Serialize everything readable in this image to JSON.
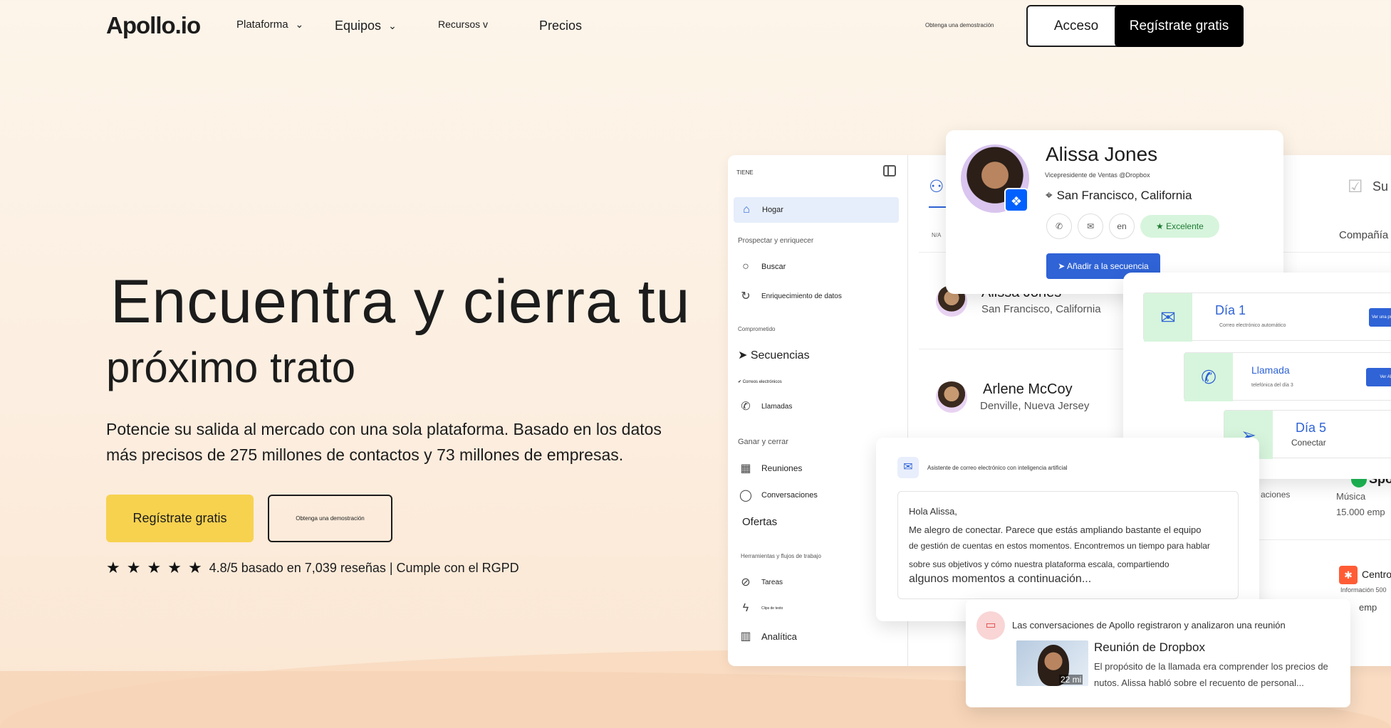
{
  "nav": {
    "logo": "Apollo.io",
    "items": [
      {
        "label": "Plataforma",
        "chevron": "⌄"
      },
      {
        "label": "Equipos",
        "chevron": "⌄"
      },
      {
        "label": "Recursos v"
      },
      {
        "label": "Precios"
      }
    ],
    "demo_link": "Obtenga una demostración",
    "login": "Acceso",
    "signup": "Regístrate gratis"
  },
  "hero": {
    "title_line1": "Encuentra y cierra tu",
    "title_line2": "próximo trato",
    "subtitle": "Potencie su salida al mercado con una sola plataforma. Basado en los datos más precisos de 275 millones de contactos y 73 millones de empresas.",
    "cta_primary": "Regístrate gratis",
    "cta_secondary": "Obtenga una demostración",
    "rating": 5,
    "rating_text": "4.8/5 basado en 7,039 reseñas | Cumple con el RGPD"
  },
  "app": {
    "sidebar": {
      "title": "TIENE",
      "home": "Hogar",
      "sec_prospect": "Prospectar y enriquecer",
      "search": "Buscar",
      "enrich": "Enriquecimiento de datos",
      "sec_engaged": "Comprometido",
      "sequences": "➤ Secuencias",
      "emails": "✔ Correos electrónicos",
      "calls": "Llamadas",
      "sec_win": "Ganar y cerrar",
      "meetings": "Reuniones",
      "conversations": "Conversaciones",
      "offers": "Ofertas",
      "sec_tools": "Herramientas y flujos de trabajo",
      "tasks": "Tareas",
      "snippets": "Clips de texto",
      "analytics": "Analítica"
    },
    "tabs": {
      "su": "Su",
      "company": "Compañía",
      "na": "N/A"
    },
    "rows": [
      {
        "name": "Alissa Jones",
        "location": "San Francisco, California"
      },
      {
        "name": "Arlene McCoy",
        "location": "Denville, Nueva Jersey"
      }
    ],
    "companies": {
      "spotify": "Spo",
      "music": "Música",
      "emp1": "15.000 emp",
      "aciones": "aciones",
      "centro": "Centro",
      "info500": "Información 500",
      "emp2": "emp"
    }
  },
  "profile": {
    "name": "Alissa Jones",
    "title": "Vicepresidente de Ventas @Dropbox",
    "location": "San Francisco, California",
    "lang": "en",
    "badge": "★ Excelente",
    "add_btn": "➤ Añadir a la secuencia"
  },
  "sequence": {
    "steps": [
      {
        "title": "Día 1",
        "sub": "Correo electrónico automático",
        "btn": "Ver una prueba A/B"
      },
      {
        "title": "Llamada",
        "sub": "telefónica del día 3",
        "btn": "Ver AI T"
      },
      {
        "title": "Día 5",
        "sub": "Conectar"
      }
    ]
  },
  "email": {
    "title": "Asistente de correo electrónico con inteligencia artificial",
    "greeting": "Hola Alissa,",
    "line1": "Me alegro de conectar. Parece que estás ampliando bastante el equipo",
    "line2": "de gestión de cuentas en estos momentos. Encontremos un tiempo para hablar",
    "line3": "sobre sus objetivos y cómo nuestra plataforma escala, compartiendo",
    "line4": "algunos momentos a continuación..."
  },
  "meeting": {
    "title": "Las conversaciones de Apollo registraron y analizaron una reunión",
    "name": "Reunión de Dropbox",
    "duration": "22 mi",
    "desc": "El propósito de la llamada era comprender los precios de nutos. Alissa habló sobre el recuento de personal..."
  }
}
